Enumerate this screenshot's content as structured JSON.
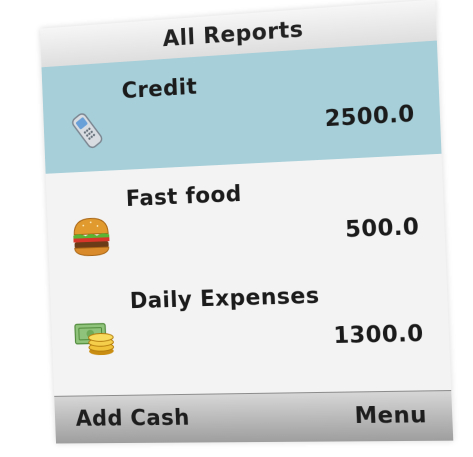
{
  "title": "All Reports",
  "items": [
    {
      "label": "Credit",
      "value": "2500.0",
      "icon": "phone-icon",
      "selected": true
    },
    {
      "label": "Fast food",
      "value": "500.0",
      "icon": "burger-icon",
      "selected": false
    },
    {
      "label": "Daily Expenses",
      "value": "1300.0",
      "icon": "cash-coins-icon",
      "selected": false
    }
  ],
  "softkeys": {
    "left": "Add Cash",
    "right": "Menu"
  },
  "colors": {
    "selected_background": "#a6cfd9",
    "screen_background": "#f3f3f3",
    "softbar": "#b8b8b8"
  }
}
